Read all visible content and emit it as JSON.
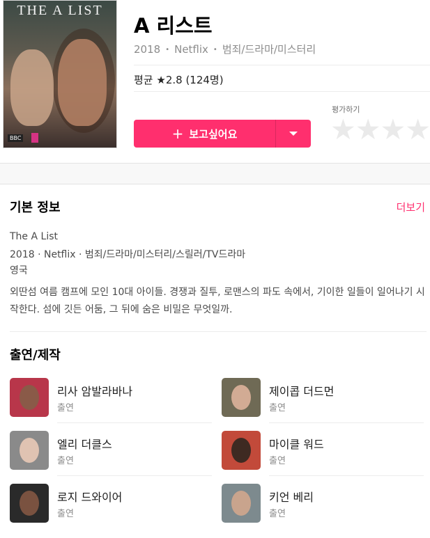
{
  "header": {
    "poster_title": "THE A LIST",
    "poster_badge": "BBC",
    "title": "A 리스트",
    "year": "2018",
    "dot": "•",
    "network": "Netflix",
    "genre": "범죄/드라마/미스터리",
    "rating_text": "평균 ★2.8 (124명)",
    "rate_label": "평가하기",
    "stars": [
      "★",
      "★",
      "★",
      "★"
    ],
    "wish_label": "보고싶어요",
    "wish_icon": "+"
  },
  "basic_info": {
    "title": "기본 정보",
    "more": "더보기",
    "original_title": "The A List",
    "details": "2018 · Netflix · 범죄/드라마/미스터리/스릴러/TV드라마",
    "country": "영국",
    "synopsis": "외딴섬 여름 캠프에 모인 10대 아이들. 경쟁과 질투, 로맨스의 파도 속에서, 기이한 일들이 일어나기 시작한다. 섬에 깃든 어둠, 그 뒤에 숨은 비밀은 무엇일까."
  },
  "cast": {
    "title": "출연/제작",
    "items": [
      {
        "name": "리사 암발라바나",
        "role": "출연",
        "color": "#b8364a"
      },
      {
        "name": "제이콥 더드먼",
        "role": "출연",
        "color": "#6f6a55"
      },
      {
        "name": "엘리 더클스",
        "role": "출연",
        "color": "#8a8a8a"
      },
      {
        "name": "마이클 워드",
        "role": "출연",
        "color": "#c24a3a"
      },
      {
        "name": "로지 드와이어",
        "role": "출연",
        "color": "#2a2a2a"
      },
      {
        "name": "키언 베리",
        "role": "출연",
        "color": "#7d8a8e"
      }
    ]
  },
  "colors": {
    "accent": "#ff2f6e",
    "text_muted": "#8c8c8c",
    "star_empty": "#eaeaea"
  }
}
